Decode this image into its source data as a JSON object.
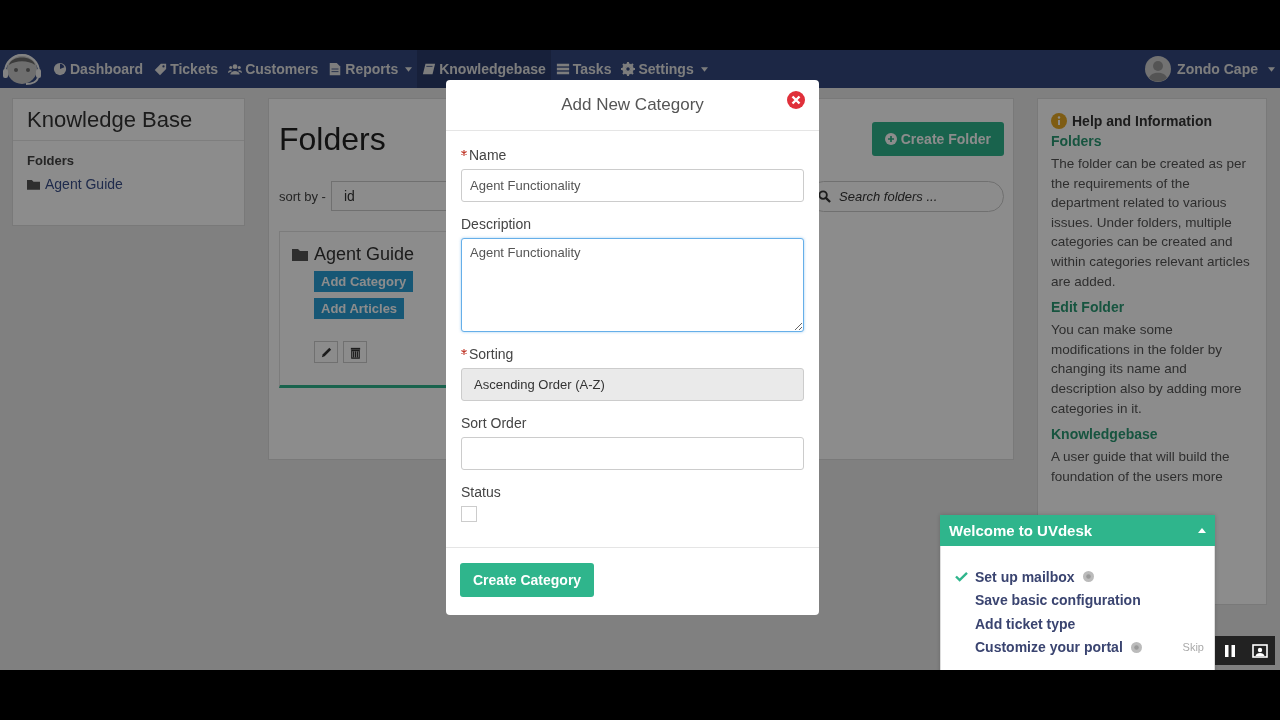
{
  "navbar": {
    "items": [
      {
        "label": "Dashboard",
        "selected": false,
        "dropdown": false
      },
      {
        "label": "Tickets",
        "selected": false,
        "dropdown": false
      },
      {
        "label": "Customers",
        "selected": false,
        "dropdown": false
      },
      {
        "label": "Reports",
        "selected": false,
        "dropdown": true
      },
      {
        "label": "Knowledgebase",
        "selected": true,
        "dropdown": false
      },
      {
        "label": "Tasks",
        "selected": false,
        "dropdown": false
      },
      {
        "label": "Settings",
        "selected": false,
        "dropdown": true
      }
    ],
    "user": {
      "name": "Zondo Cape"
    }
  },
  "sidebar": {
    "title": "Knowledge Base",
    "section": "Folders",
    "items": [
      {
        "label": "Agent Guide"
      }
    ]
  },
  "main": {
    "title": "Folders",
    "create_button": "Create Folder",
    "sort_label": "sort by -",
    "sort_value": "id",
    "search": {
      "placeholder": "Search folders ..."
    },
    "folders": [
      {
        "name": "Agent Guide",
        "buttons": [
          "Add Category",
          "Add Articles"
        ]
      }
    ]
  },
  "help": {
    "title": "Help and Information",
    "sections": [
      {
        "heading": "Folders",
        "text": "The folder can be created as per the requirements of the department related to various issues. Under folders, multiple categories can be created and within categories relevant articles are added."
      },
      {
        "heading": "Edit Folder",
        "text": "You can make some modifications in the folder by changing its name and description also by adding more categories in it."
      },
      {
        "heading": "Knowledgebase",
        "text": "A user guide that will build the foundation of the users more"
      }
    ]
  },
  "dialog": {
    "title": "Add New Category",
    "fields": [
      {
        "kind": "text",
        "label": "Name",
        "required": true,
        "value": "Agent Functionality"
      },
      {
        "kind": "textarea",
        "label": "Description",
        "required": false,
        "value": "Agent Functionality",
        "focused": true
      },
      {
        "kind": "select",
        "label": "Sorting",
        "required": true,
        "value": "Ascending Order (A-Z)"
      },
      {
        "kind": "text",
        "label": "Sort Order",
        "required": false
      },
      {
        "kind": "checkbox",
        "label": "Status",
        "required": false,
        "checked": false
      }
    ],
    "submit": "Create Category"
  },
  "welcome": {
    "title": "Welcome to UVdesk",
    "expanded": true,
    "steps": [
      {
        "label": "Set up mailbox",
        "done": true,
        "help": true
      },
      {
        "label": "Save basic configuration",
        "done": false,
        "help": false
      },
      {
        "label": "Add ticket type",
        "done": false,
        "help": false
      },
      {
        "label": "Customize your portal",
        "done": false,
        "help": true
      }
    ],
    "skip": "Skip"
  }
}
